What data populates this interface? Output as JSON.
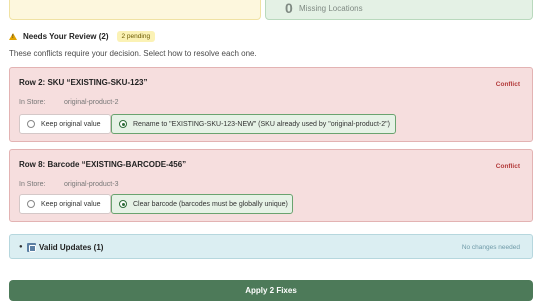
{
  "summary": {
    "missing_count": "0",
    "missing_label": "Missing Locations"
  },
  "review": {
    "title": "Needs Your Review (2)",
    "badge": "2 pending",
    "description": "These conflicts require your decision. Select how to resolve each one."
  },
  "conflicts": [
    {
      "title": "Row 2: SKU “EXISTING-SKU-123”",
      "tag": "Conflict",
      "store_label": "In Store:",
      "store_value": "original-product-2",
      "keep_label": "Keep original value",
      "alt_label": "Rename to \"EXISTING-SKU-123-NEW\" (SKU already used by \"original-product-2\")",
      "selected": "alt"
    },
    {
      "title": "Row 8: Barcode “EXISTING-BARCODE-456”",
      "tag": "Conflict",
      "store_label": "In Store:",
      "store_value": "original-product-3",
      "keep_label": "Keep original value",
      "alt_label": "Clear barcode (barcodes must be globally unique)",
      "selected": "alt"
    }
  ],
  "valid_updates": {
    "title": "Valid Updates (1)",
    "note": "No changes needed"
  },
  "apply_button": "Apply 2 Fixes",
  "colors": {
    "conflict_bg": "#f6dede",
    "selected_bg": "#e6f2e6",
    "apply_bg": "#4d7a59",
    "info_bg": "#dbeef2"
  },
  "icons": {
    "section": "warning-icon",
    "valid": "box-icon"
  }
}
